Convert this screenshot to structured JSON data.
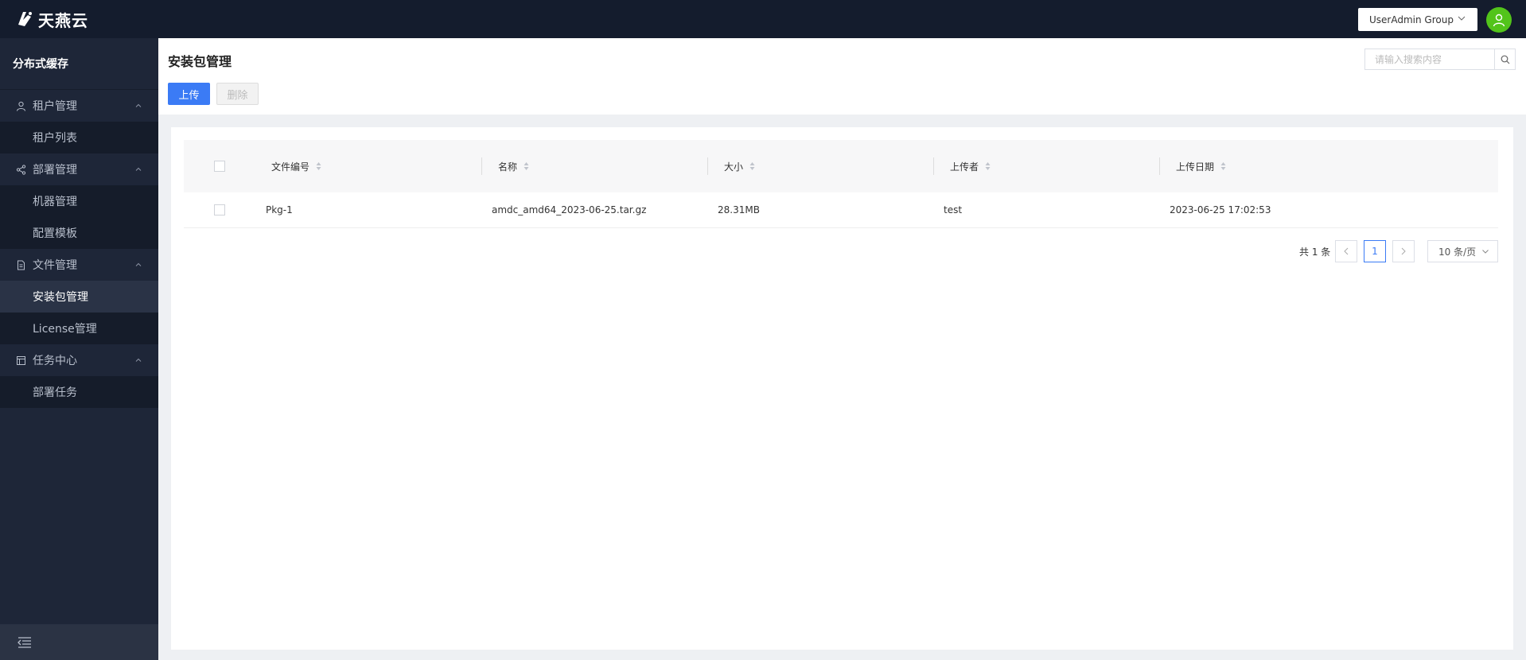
{
  "brand": {
    "name": "天燕云"
  },
  "topbar": {
    "group_select": "UserAdmin Group"
  },
  "sidebar": {
    "title": "分布式缓存",
    "groups": [
      {
        "label": "租户管理",
        "icon": "user-icon",
        "items": [
          "租户列表"
        ]
      },
      {
        "label": "部署管理",
        "icon": "share-icon",
        "items": [
          "机器管理",
          "配置模板"
        ]
      },
      {
        "label": "文件管理",
        "icon": "file-icon",
        "items": [
          "安装包管理",
          "License管理"
        ]
      },
      {
        "label": "任务中心",
        "icon": "task-icon",
        "items": [
          "部署任务"
        ]
      }
    ],
    "active_item": "安装包管理"
  },
  "page": {
    "title": "安装包管理",
    "search_placeholder": "请输入搜索内容",
    "upload_label": "上传",
    "delete_label": "删除"
  },
  "table": {
    "columns": [
      "文件编号",
      "名称",
      "大小",
      "上传者",
      "上传日期"
    ],
    "rows": [
      [
        "Pkg-1",
        "amdc_amd64_2023-06-25.tar.gz",
        "28.31MB",
        "test",
        "2023-06-25 17:02:53"
      ]
    ]
  },
  "pagination": {
    "total_text": "共 1 条",
    "current_page": "1",
    "page_size": "10 条/页"
  },
  "colors": {
    "topbar": "#141c2d",
    "sidebar": "#1e2638",
    "accent": "#3b7bf5",
    "avatar": "#52c41a"
  }
}
